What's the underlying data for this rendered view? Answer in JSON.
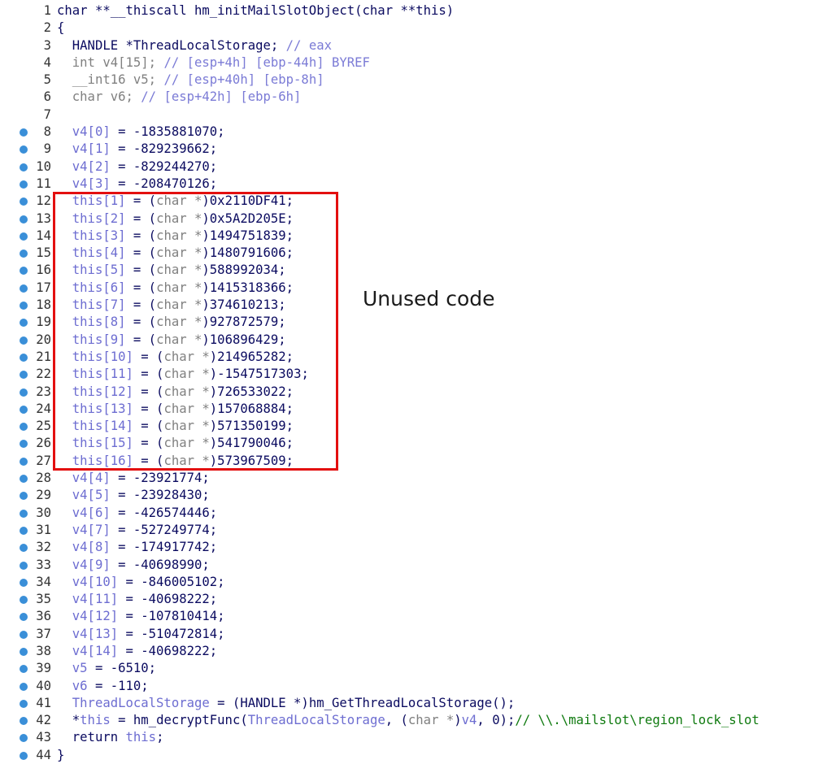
{
  "annotation": {
    "label": "Unused code",
    "box_color": "#e30f0f"
  },
  "colors": {
    "plain": "#0b0b60",
    "gray_keyword": "#808080",
    "comment": "#7b7bd6",
    "variable": "#6d6dd1",
    "mailslot_comment": "#0f7a0f",
    "breakpoint_dot": "#3a8fd8"
  },
  "lines": [
    {
      "n": "1",
      "dot": false,
      "tokens": [
        [
          "p",
          "char **__thiscall hm_initMailSlotObject(char **this)"
        ]
      ]
    },
    {
      "n": "2",
      "dot": false,
      "tokens": [
        [
          "p",
          "{"
        ]
      ]
    },
    {
      "n": "3",
      "dot": false,
      "tokens": [
        [
          "p",
          "  HANDLE *ThreadLocalStorage; "
        ],
        [
          "c",
          "// eax"
        ]
      ]
    },
    {
      "n": "4",
      "dot": false,
      "tokens": [
        [
          "g",
          "  int v4[15]; "
        ],
        [
          "c",
          "// [esp+4h] [ebp-44h] BYREF"
        ]
      ]
    },
    {
      "n": "5",
      "dot": false,
      "tokens": [
        [
          "g",
          "  __int16 v5; "
        ],
        [
          "c",
          "// [esp+40h] [ebp-8h]"
        ]
      ]
    },
    {
      "n": "6",
      "dot": false,
      "tokens": [
        [
          "g",
          "  char v6; "
        ],
        [
          "c",
          "// [esp+42h] [ebp-6h]"
        ]
      ]
    },
    {
      "n": "7",
      "dot": false,
      "tokens": [
        [
          "p",
          ""
        ]
      ]
    },
    {
      "n": "8",
      "dot": true,
      "tokens": [
        [
          "v",
          "  v4[0]"
        ],
        [
          "p",
          " = -1835881070;"
        ]
      ]
    },
    {
      "n": "9",
      "dot": true,
      "tokens": [
        [
          "v",
          "  v4[1]"
        ],
        [
          "p",
          " = -829239662;"
        ]
      ]
    },
    {
      "n": "10",
      "dot": true,
      "tokens": [
        [
          "v",
          "  v4[2]"
        ],
        [
          "p",
          " = -829244270;"
        ]
      ]
    },
    {
      "n": "11",
      "dot": true,
      "tokens": [
        [
          "v",
          "  v4[3]"
        ],
        [
          "p",
          " = -208470126;"
        ]
      ]
    },
    {
      "n": "12",
      "dot": true,
      "tokens": [
        [
          "v",
          "  this[1]"
        ],
        [
          "p",
          " = ("
        ],
        [
          "g",
          "char *"
        ],
        [
          "p",
          ")0x2110DF41;"
        ]
      ]
    },
    {
      "n": "13",
      "dot": true,
      "tokens": [
        [
          "v",
          "  this[2]"
        ],
        [
          "p",
          " = ("
        ],
        [
          "g",
          "char *"
        ],
        [
          "p",
          ")0x5A2D205E;"
        ]
      ]
    },
    {
      "n": "14",
      "dot": true,
      "tokens": [
        [
          "v",
          "  this[3]"
        ],
        [
          "p",
          " = ("
        ],
        [
          "g",
          "char *"
        ],
        [
          "p",
          ")1494751839;"
        ]
      ]
    },
    {
      "n": "15",
      "dot": true,
      "tokens": [
        [
          "v",
          "  this[4]"
        ],
        [
          "p",
          " = ("
        ],
        [
          "g",
          "char *"
        ],
        [
          "p",
          ")1480791606;"
        ]
      ]
    },
    {
      "n": "16",
      "dot": true,
      "tokens": [
        [
          "v",
          "  this[5]"
        ],
        [
          "p",
          " = ("
        ],
        [
          "g",
          "char *"
        ],
        [
          "p",
          ")588992034;"
        ]
      ]
    },
    {
      "n": "17",
      "dot": true,
      "tokens": [
        [
          "v",
          "  this[6]"
        ],
        [
          "p",
          " = ("
        ],
        [
          "g",
          "char *"
        ],
        [
          "p",
          ")1415318366;"
        ]
      ]
    },
    {
      "n": "18",
      "dot": true,
      "tokens": [
        [
          "v",
          "  this[7]"
        ],
        [
          "p",
          " = ("
        ],
        [
          "g",
          "char *"
        ],
        [
          "p",
          ")374610213;"
        ]
      ]
    },
    {
      "n": "19",
      "dot": true,
      "tokens": [
        [
          "v",
          "  this[8]"
        ],
        [
          "p",
          " = ("
        ],
        [
          "g",
          "char *"
        ],
        [
          "p",
          ")927872579;"
        ]
      ]
    },
    {
      "n": "20",
      "dot": true,
      "tokens": [
        [
          "v",
          "  this[9]"
        ],
        [
          "p",
          " = ("
        ],
        [
          "g",
          "char *"
        ],
        [
          "p",
          ")106896429;"
        ]
      ]
    },
    {
      "n": "21",
      "dot": true,
      "tokens": [
        [
          "v",
          "  this[10]"
        ],
        [
          "p",
          " = ("
        ],
        [
          "g",
          "char *"
        ],
        [
          "p",
          ")214965282;"
        ]
      ]
    },
    {
      "n": "22",
      "dot": true,
      "tokens": [
        [
          "v",
          "  this[11]"
        ],
        [
          "p",
          " = ("
        ],
        [
          "g",
          "char *"
        ],
        [
          "p",
          ")-1547517303;"
        ]
      ]
    },
    {
      "n": "23",
      "dot": true,
      "tokens": [
        [
          "v",
          "  this[12]"
        ],
        [
          "p",
          " = ("
        ],
        [
          "g",
          "char *"
        ],
        [
          "p",
          ")726533022;"
        ]
      ]
    },
    {
      "n": "24",
      "dot": true,
      "tokens": [
        [
          "v",
          "  this[13]"
        ],
        [
          "p",
          " = ("
        ],
        [
          "g",
          "char *"
        ],
        [
          "p",
          ")157068884;"
        ]
      ]
    },
    {
      "n": "25",
      "dot": true,
      "tokens": [
        [
          "v",
          "  this[14]"
        ],
        [
          "p",
          " = ("
        ],
        [
          "g",
          "char *"
        ],
        [
          "p",
          ")571350199;"
        ]
      ]
    },
    {
      "n": "26",
      "dot": true,
      "tokens": [
        [
          "v",
          "  this[15]"
        ],
        [
          "p",
          " = ("
        ],
        [
          "g",
          "char *"
        ],
        [
          "p",
          ")541790046;"
        ]
      ]
    },
    {
      "n": "27",
      "dot": true,
      "tokens": [
        [
          "v",
          "  this[16]"
        ],
        [
          "p",
          " = ("
        ],
        [
          "g",
          "char *"
        ],
        [
          "p",
          ")573967509;"
        ]
      ]
    },
    {
      "n": "28",
      "dot": true,
      "tokens": [
        [
          "v",
          "  v4[4]"
        ],
        [
          "p",
          " = -23921774;"
        ]
      ]
    },
    {
      "n": "29",
      "dot": true,
      "tokens": [
        [
          "v",
          "  v4[5]"
        ],
        [
          "p",
          " = -23928430;"
        ]
      ]
    },
    {
      "n": "30",
      "dot": true,
      "tokens": [
        [
          "v",
          "  v4[6]"
        ],
        [
          "p",
          " = -426574446;"
        ]
      ]
    },
    {
      "n": "31",
      "dot": true,
      "tokens": [
        [
          "v",
          "  v4[7]"
        ],
        [
          "p",
          " = -527249774;"
        ]
      ]
    },
    {
      "n": "32",
      "dot": true,
      "tokens": [
        [
          "v",
          "  v4[8]"
        ],
        [
          "p",
          " = -174917742;"
        ]
      ]
    },
    {
      "n": "33",
      "dot": true,
      "tokens": [
        [
          "v",
          "  v4[9]"
        ],
        [
          "p",
          " = -40698990;"
        ]
      ]
    },
    {
      "n": "34",
      "dot": true,
      "tokens": [
        [
          "v",
          "  v4[10]"
        ],
        [
          "p",
          " = -846005102;"
        ]
      ]
    },
    {
      "n": "35",
      "dot": true,
      "tokens": [
        [
          "v",
          "  v4[11]"
        ],
        [
          "p",
          " = -40698222;"
        ]
      ]
    },
    {
      "n": "36",
      "dot": true,
      "tokens": [
        [
          "v",
          "  v4[12]"
        ],
        [
          "p",
          " = -107810414;"
        ]
      ]
    },
    {
      "n": "37",
      "dot": true,
      "tokens": [
        [
          "v",
          "  v4[13]"
        ],
        [
          "p",
          " = -510472814;"
        ]
      ]
    },
    {
      "n": "38",
      "dot": true,
      "tokens": [
        [
          "v",
          "  v4[14]"
        ],
        [
          "p",
          " = -40698222;"
        ]
      ]
    },
    {
      "n": "39",
      "dot": true,
      "tokens": [
        [
          "v",
          "  v5"
        ],
        [
          "p",
          " = -6510;"
        ]
      ]
    },
    {
      "n": "40",
      "dot": true,
      "tokens": [
        [
          "v",
          "  v6"
        ],
        [
          "p",
          " = -110;"
        ]
      ]
    },
    {
      "n": "41",
      "dot": true,
      "tokens": [
        [
          "v",
          "  ThreadLocalStorage"
        ],
        [
          "p",
          " = (HANDLE *)hm_GetThreadLocalStorage();"
        ]
      ]
    },
    {
      "n": "42",
      "dot": true,
      "tokens": [
        [
          "p",
          "  *"
        ],
        [
          "v",
          "this"
        ],
        [
          "p",
          " = hm_decryptFunc("
        ],
        [
          "v",
          "ThreadLocalStorage"
        ],
        [
          "p",
          ", ("
        ],
        [
          "g",
          "char *"
        ],
        [
          "p",
          ")"
        ],
        [
          "v",
          "v4"
        ],
        [
          "p",
          ", 0);"
        ],
        [
          "m",
          "// \\\\.\\mailslot\\region_lock_slot"
        ]
      ]
    },
    {
      "n": "43",
      "dot": true,
      "tokens": [
        [
          "p",
          "  return "
        ],
        [
          "v",
          "this"
        ],
        [
          "p",
          ";"
        ]
      ]
    },
    {
      "n": "44",
      "dot": true,
      "tokens": [
        [
          "p",
          "}"
        ]
      ]
    }
  ]
}
